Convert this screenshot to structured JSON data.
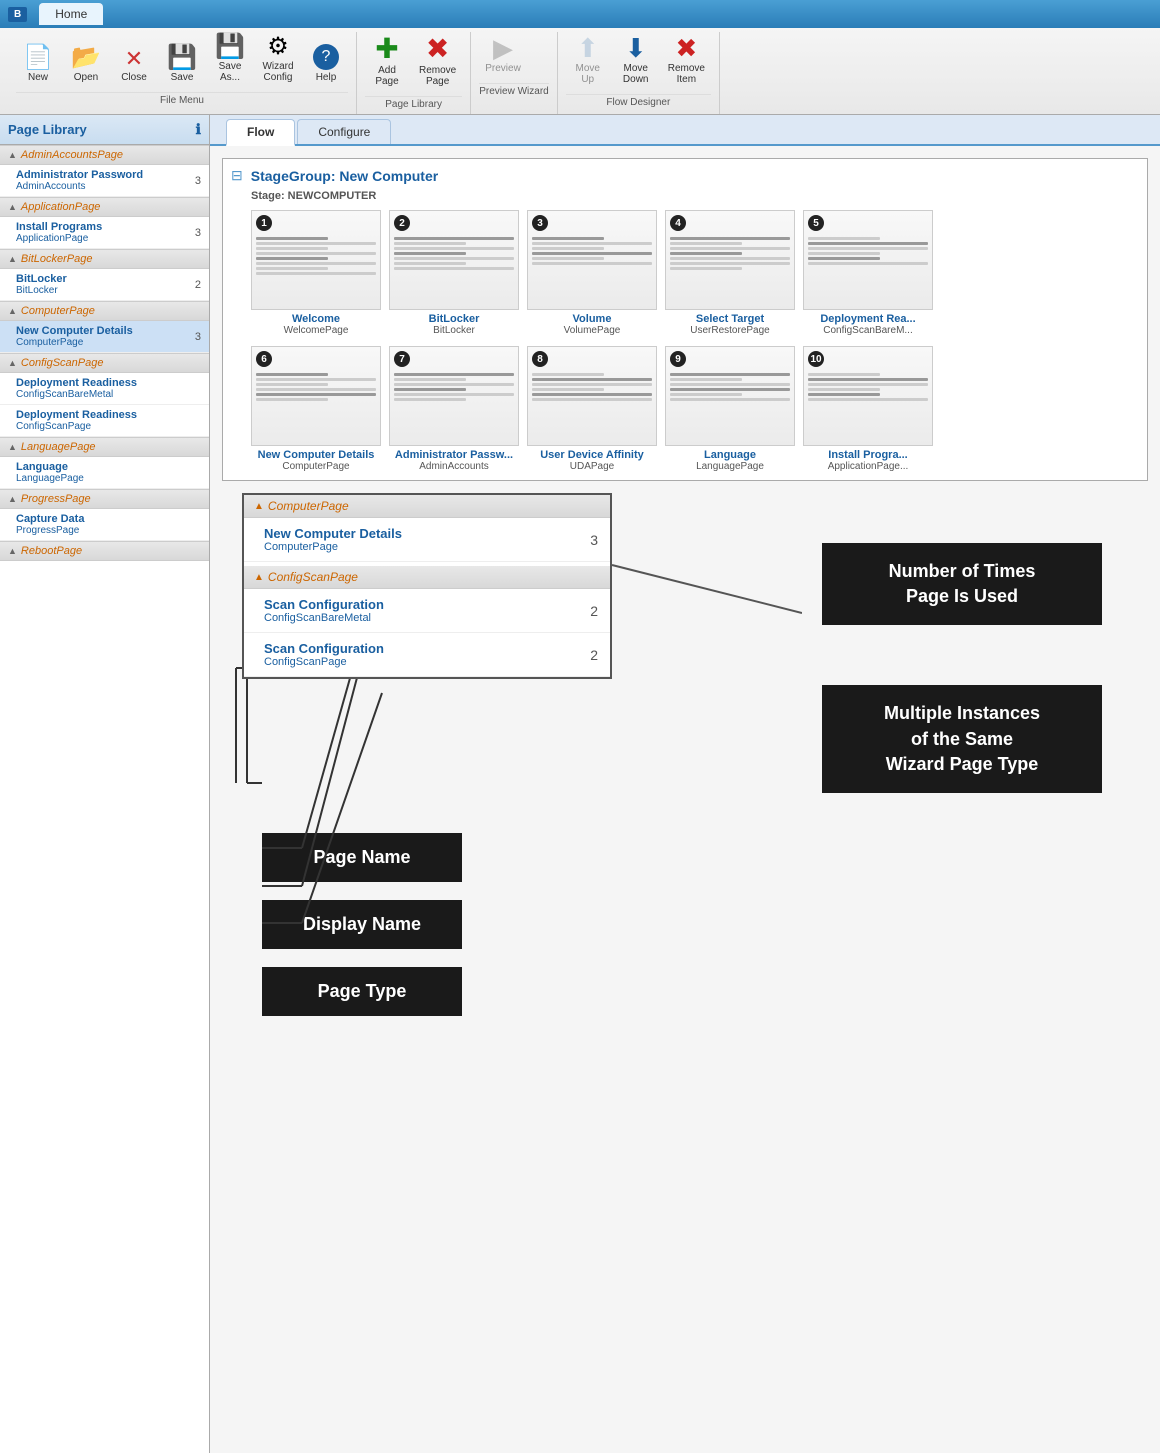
{
  "titleBar": {
    "logoText": "B",
    "tabLabel": "Home"
  },
  "ribbon": {
    "groups": [
      {
        "label": "File Menu",
        "buttons": [
          {
            "id": "new",
            "icon": "📄",
            "label": "New",
            "small": false
          },
          {
            "id": "open",
            "icon": "📂",
            "label": "Open",
            "small": false
          },
          {
            "id": "close",
            "icon": "✕",
            "label": "Close",
            "small": false
          },
          {
            "id": "save",
            "icon": "💾",
            "label": "Save",
            "small": false
          },
          {
            "id": "save-as",
            "icon": "💾",
            "label": "Save\nAs...",
            "small": false
          },
          {
            "id": "wizard-config",
            "icon": "⚙",
            "label": "Wizard\nConfig",
            "small": false
          },
          {
            "id": "help",
            "icon": "❓",
            "label": "Help",
            "small": false
          }
        ]
      },
      {
        "label": "Page Library",
        "buttons": [
          {
            "id": "add-page",
            "icon": "➕",
            "label": "Add\nPage",
            "small": false
          },
          {
            "id": "remove-page",
            "icon": "✖",
            "label": "Remove\nPage",
            "small": false
          }
        ]
      },
      {
        "label": "Preview Wizard",
        "buttons": [
          {
            "id": "preview",
            "icon": "👁",
            "label": "Preview",
            "small": false,
            "disabled": true
          }
        ]
      },
      {
        "label": "Flow Designer",
        "buttons": [
          {
            "id": "move-up",
            "icon": "⬆",
            "label": "Move\nUp",
            "small": false,
            "disabled": true
          },
          {
            "id": "move-down",
            "icon": "⬇",
            "label": "Move\nDown",
            "small": false
          },
          {
            "id": "remove-item",
            "icon": "✖",
            "label": "Remove\nItem",
            "small": false
          }
        ]
      }
    ]
  },
  "sidebar": {
    "title": "Page Library",
    "groups": [
      {
        "id": "AdminAccountsPage",
        "label": "AdminAccountsPage",
        "items": [
          {
            "name": "Administrator Password",
            "type": "AdminAccounts",
            "count": "3",
            "selected": false
          }
        ]
      },
      {
        "id": "ApplicationPage",
        "label": "ApplicationPage",
        "items": [
          {
            "name": "Install Programs",
            "type": "ApplicationPage",
            "count": "3",
            "selected": false
          }
        ]
      },
      {
        "id": "BitLockerPage",
        "label": "BitLockerPage",
        "items": [
          {
            "name": "BitLocker",
            "type": "BitLocker",
            "count": "2",
            "selected": false
          }
        ]
      },
      {
        "id": "ComputerPage",
        "label": "ComputerPage",
        "items": [
          {
            "name": "New Computer Details",
            "type": "ComputerPage",
            "count": "3",
            "selected": true
          }
        ]
      },
      {
        "id": "ConfigScanPage",
        "label": "ConfigScanPage",
        "items": [
          {
            "name": "Deployment Readiness",
            "type": "ConfigScanBareMetal",
            "count": "",
            "selected": false
          },
          {
            "name": "Deployment Readiness",
            "type": "ConfigScanPage",
            "count": "",
            "selected": false
          }
        ]
      },
      {
        "id": "LanguagePage",
        "label": "LanguagePage",
        "items": [
          {
            "name": "Language",
            "type": "LanguagePage",
            "count": "",
            "selected": false
          }
        ]
      },
      {
        "id": "ProgressPage",
        "label": "ProgressPage",
        "items": [
          {
            "name": "Capture Data",
            "type": "ProgressPage",
            "count": "",
            "selected": false
          }
        ]
      },
      {
        "id": "RebootPage",
        "label": "RebootPage",
        "items": []
      }
    ]
  },
  "tabs": [
    {
      "id": "flow",
      "label": "Flow",
      "active": true
    },
    {
      "id": "configure",
      "label": "Configure",
      "active": false
    }
  ],
  "stageGroup": {
    "title": "StageGroup: New Computer",
    "stageLabel": "Stage: NEWCOMPUTER",
    "pages": [
      {
        "num": 1,
        "name": "Welcome",
        "type": "WelcomePage"
      },
      {
        "num": 2,
        "name": "BitLocker",
        "type": "BitLocker"
      },
      {
        "num": 3,
        "name": "Volume",
        "type": "VolumePage"
      },
      {
        "num": 4,
        "name": "Select Target",
        "type": "UserRestorePage"
      },
      {
        "num": 5,
        "name": "Deployment Rea...",
        "type": "ConfigScanBareM..."
      },
      {
        "num": 6,
        "name": "New Computer Details",
        "type": "ComputerPage"
      },
      {
        "num": 7,
        "name": "Administrator Passw...",
        "type": "AdminAccounts"
      },
      {
        "num": 8,
        "name": "User Device Affinity",
        "type": "UDAPage"
      },
      {
        "num": 9,
        "name": "Language",
        "type": "LanguagePage"
      },
      {
        "num": 10,
        "name": "Install Progra...",
        "type": "ApplicationPage..."
      }
    ]
  },
  "zoomedPanel": {
    "groups": [
      {
        "label": "ComputerPage",
        "items": [
          {
            "name": "New Computer Details",
            "type": "ComputerPage",
            "count": "3"
          }
        ]
      },
      {
        "label": "ConfigScanPage",
        "items": [
          {
            "name": "Scan Configuration",
            "type": "ConfigScanBareMetal",
            "count": "2"
          },
          {
            "name": "Scan Configuration",
            "type": "ConfigScanPage",
            "count": "2"
          }
        ]
      }
    ]
  },
  "callouts": {
    "timesUsed": "Number of Times\nPage Is Used",
    "multipleInstances": "Multiple Instances\nof the Same\nWizard Page Type"
  },
  "annotations": {
    "pageName": "Page Name",
    "displayName": "Display Name",
    "pageType": "Page Type"
  }
}
